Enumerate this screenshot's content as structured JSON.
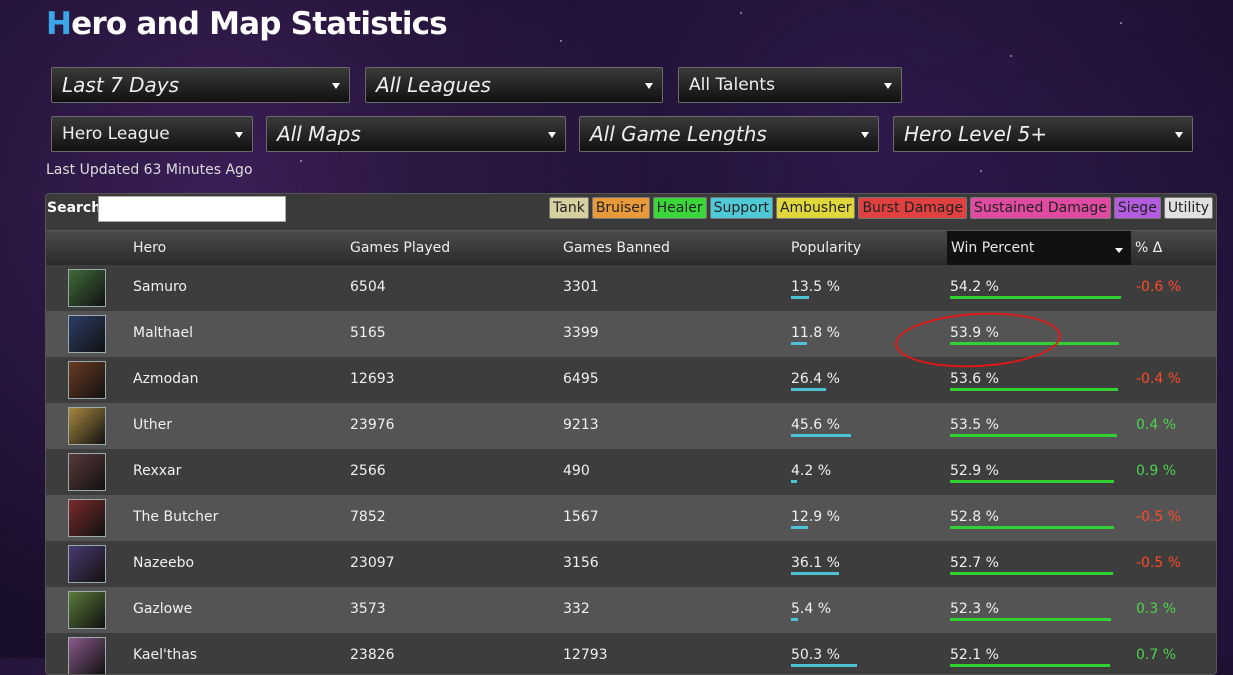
{
  "page": {
    "title_first": "H",
    "title_rest": "ero and Map Statistics",
    "last_updated": "Last Updated 63 Minutes Ago"
  },
  "filters": {
    "time": "Last 7 Days",
    "leagues": "All Leagues",
    "talents": "All Talents",
    "mode": "Hero League",
    "maps": "All Maps",
    "lengths": "All Game Lengths",
    "level": "Hero Level 5+"
  },
  "search": {
    "label": "Search:"
  },
  "roles": [
    {
      "label": "Tank",
      "color": "#d8cfa0"
    },
    {
      "label": "Bruiser",
      "color": "#e89a3a"
    },
    {
      "label": "Healer",
      "color": "#3ad63a"
    },
    {
      "label": "Support",
      "color": "#4fc9d6"
    },
    {
      "label": "Ambusher",
      "color": "#e0d83a"
    },
    {
      "label": "Burst Damage",
      "color": "#e04040"
    },
    {
      "label": "Sustained Damage",
      "color": "#e04aa0"
    },
    {
      "label": "Siege",
      "color": "#b35ce0"
    },
    {
      "label": "Utility",
      "color": "#e0e0e0"
    }
  ],
  "columns": {
    "hero": "Hero",
    "played": "Games Played",
    "banned": "Games Banned",
    "popularity": "Popularity",
    "win": "Win Percent",
    "delta": "% Δ"
  },
  "rows": [
    {
      "hero": "Samuro",
      "played": "6504",
      "banned": "3301",
      "popularity": "13.5 %",
      "pop": 13.5,
      "win": "54.2 %",
      "winv": 54.2,
      "delta": "-0.6 %",
      "dir": "neg",
      "avatar": "#3f6a3a"
    },
    {
      "hero": "Malthael",
      "played": "5165",
      "banned": "3399",
      "popularity": "11.8 %",
      "pop": 11.8,
      "win": "53.9 %",
      "winv": 53.9,
      "delta": "",
      "dir": "neg",
      "avatar": "#2c3e66"
    },
    {
      "hero": "Azmodan",
      "played": "12693",
      "banned": "6495",
      "popularity": "26.4 %",
      "pop": 26.4,
      "win": "53.6 %",
      "winv": 53.6,
      "delta": "-0.4 %",
      "dir": "neg",
      "avatar": "#6a3a22"
    },
    {
      "hero": "Uther",
      "played": "23976",
      "banned": "9213",
      "popularity": "45.6 %",
      "pop": 45.6,
      "win": "53.5 %",
      "winv": 53.5,
      "delta": "0.4 %",
      "dir": "pos",
      "avatar": "#a88840"
    },
    {
      "hero": "Rexxar",
      "played": "2566",
      "banned": "490",
      "popularity": "4.2 %",
      "pop": 4.2,
      "win": "52.9 %",
      "winv": 52.9,
      "delta": "0.9 %",
      "dir": "pos",
      "avatar": "#5a3a3a"
    },
    {
      "hero": "The Butcher",
      "played": "7852",
      "banned": "1567",
      "popularity": "12.9 %",
      "pop": 12.9,
      "win": "52.8 %",
      "winv": 52.8,
      "delta": "-0.5 %",
      "dir": "neg",
      "avatar": "#7a2a2a"
    },
    {
      "hero": "Nazeebo",
      "played": "23097",
      "banned": "3156",
      "popularity": "36.1 %",
      "pop": 36.1,
      "win": "52.7 %",
      "winv": 52.7,
      "delta": "-0.5 %",
      "dir": "neg",
      "avatar": "#4a3a70"
    },
    {
      "hero": "Gazlowe",
      "played": "3573",
      "banned": "332",
      "popularity": "5.4 %",
      "pop": 5.4,
      "win": "52.3 %",
      "winv": 52.3,
      "delta": "0.3 %",
      "dir": "pos",
      "avatar": "#5a7a3a"
    },
    {
      "hero": "Kael'thas",
      "played": "23826",
      "banned": "12793",
      "popularity": "50.3 %",
      "pop": 50.3,
      "win": "52.1 %",
      "winv": 52.1,
      "delta": "0.7 %",
      "dir": "pos",
      "avatar": "#8a5a8a"
    }
  ]
}
